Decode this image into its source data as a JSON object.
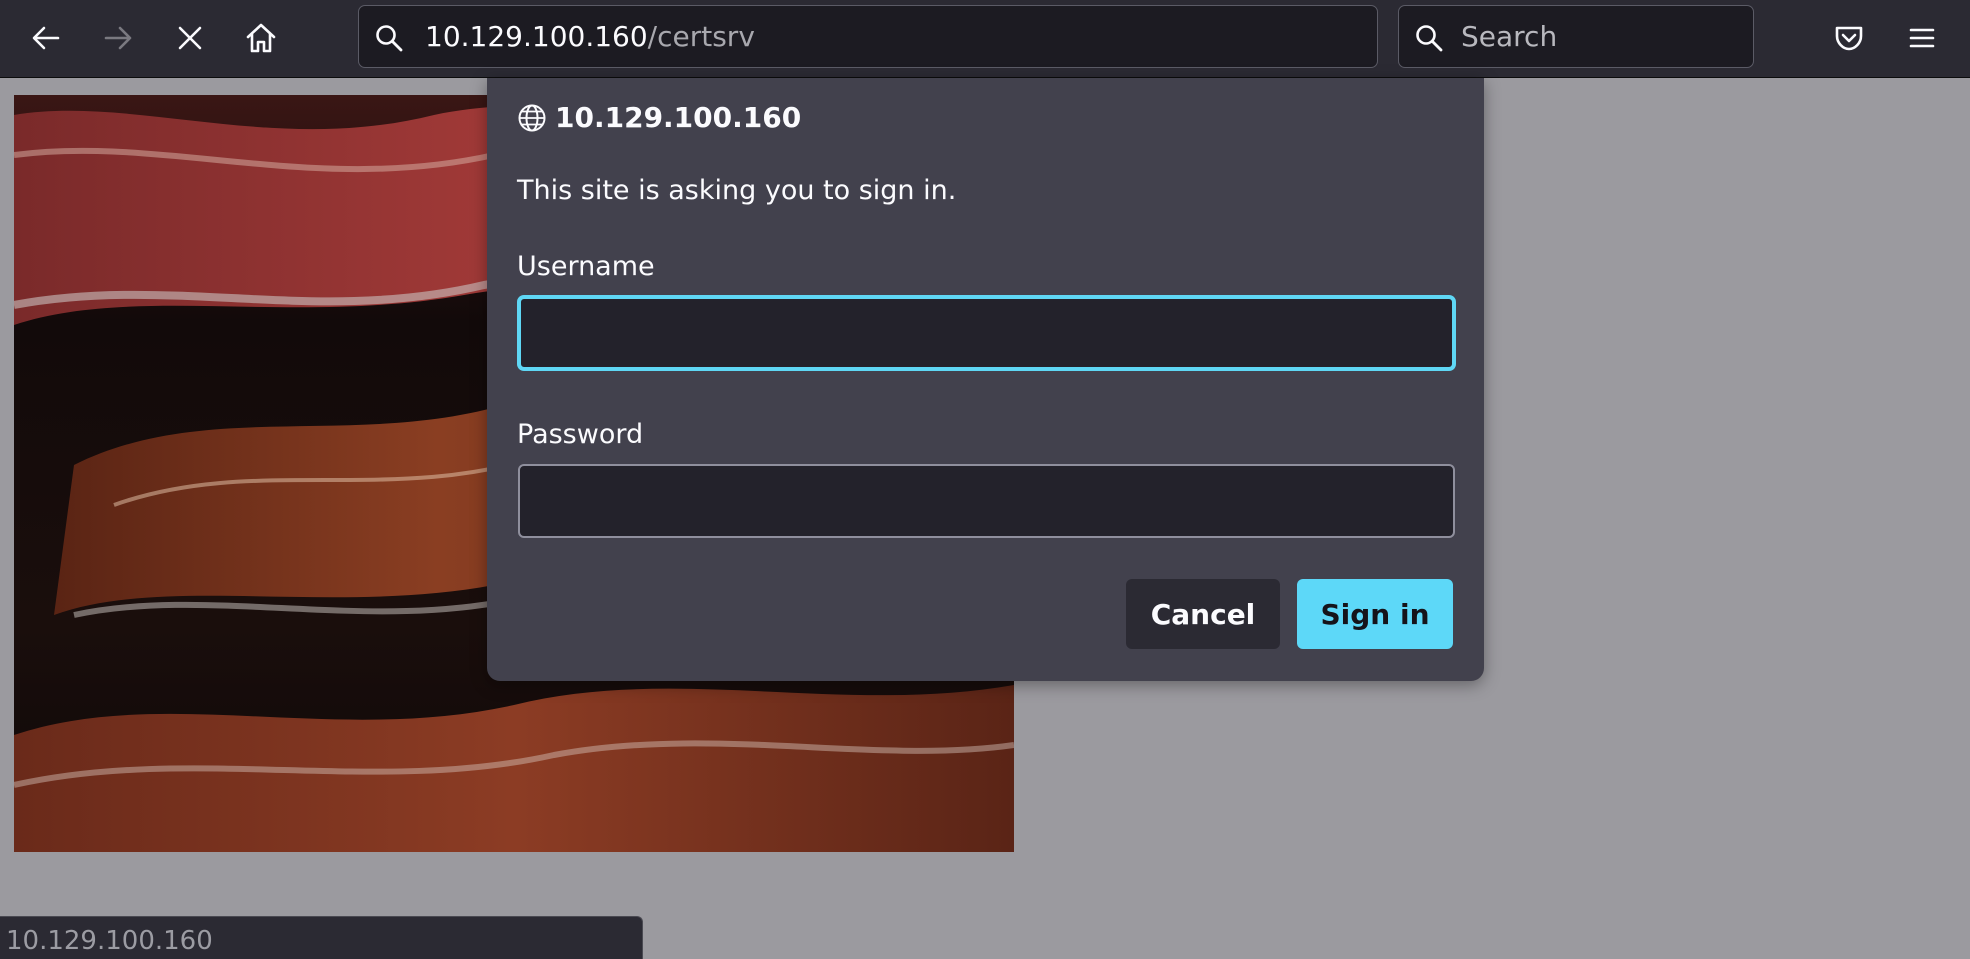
{
  "browser": {
    "back_icon": "arrow-left-icon",
    "forward_icon": "arrow-right-icon",
    "stop_icon": "close-icon",
    "home_icon": "home-icon",
    "url_host": "10.129.100.160",
    "url_path": "/certsrv",
    "search_placeholder": "Search",
    "pocket_icon": "pocket-icon",
    "menu_icon": "hamburger-menu-icon"
  },
  "dialog": {
    "host": "10.129.100.160",
    "message": "This site is asking you to sign in.",
    "username_label": "Username",
    "username_value": "",
    "password_label": "Password",
    "password_value": "",
    "cancel_label": "Cancel",
    "signin_label": "Sign in",
    "accent_color": "#5dd8f8"
  },
  "status_bar": {
    "text": "10.129.100.160"
  }
}
